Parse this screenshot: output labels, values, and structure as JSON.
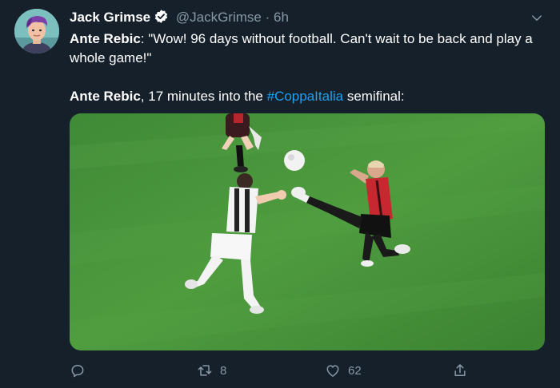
{
  "author": {
    "name": "Jack Grimse",
    "handle": "@JackGrimse",
    "separator": "·",
    "time": "6h",
    "verified": true,
    "avatar_icon": "avatar-photo"
  },
  "tweet": {
    "quote_speaker": "Ante Rebic",
    "quote_text": ": \"Wow! 96 days without football. Can't wait to be back and play a whole game!\"",
    "second_speaker": "Ante Rebic",
    "second_text": ", 17 minutes into the ",
    "hashtag": "#CoppaItalia",
    "second_tail": " semifinal:"
  },
  "actions": {
    "retweet_count": "8",
    "like_count": "62"
  },
  "colors": {
    "background": "#15202b",
    "hashtag": "#1da1f2",
    "muted": "#8899a6",
    "verified_badge": "#ffffff"
  },
  "icons": {
    "caret": "chevron-down-icon",
    "reply": "reply-icon",
    "retweet": "retweet-icon",
    "like": "heart-icon",
    "share": "share-icon"
  }
}
